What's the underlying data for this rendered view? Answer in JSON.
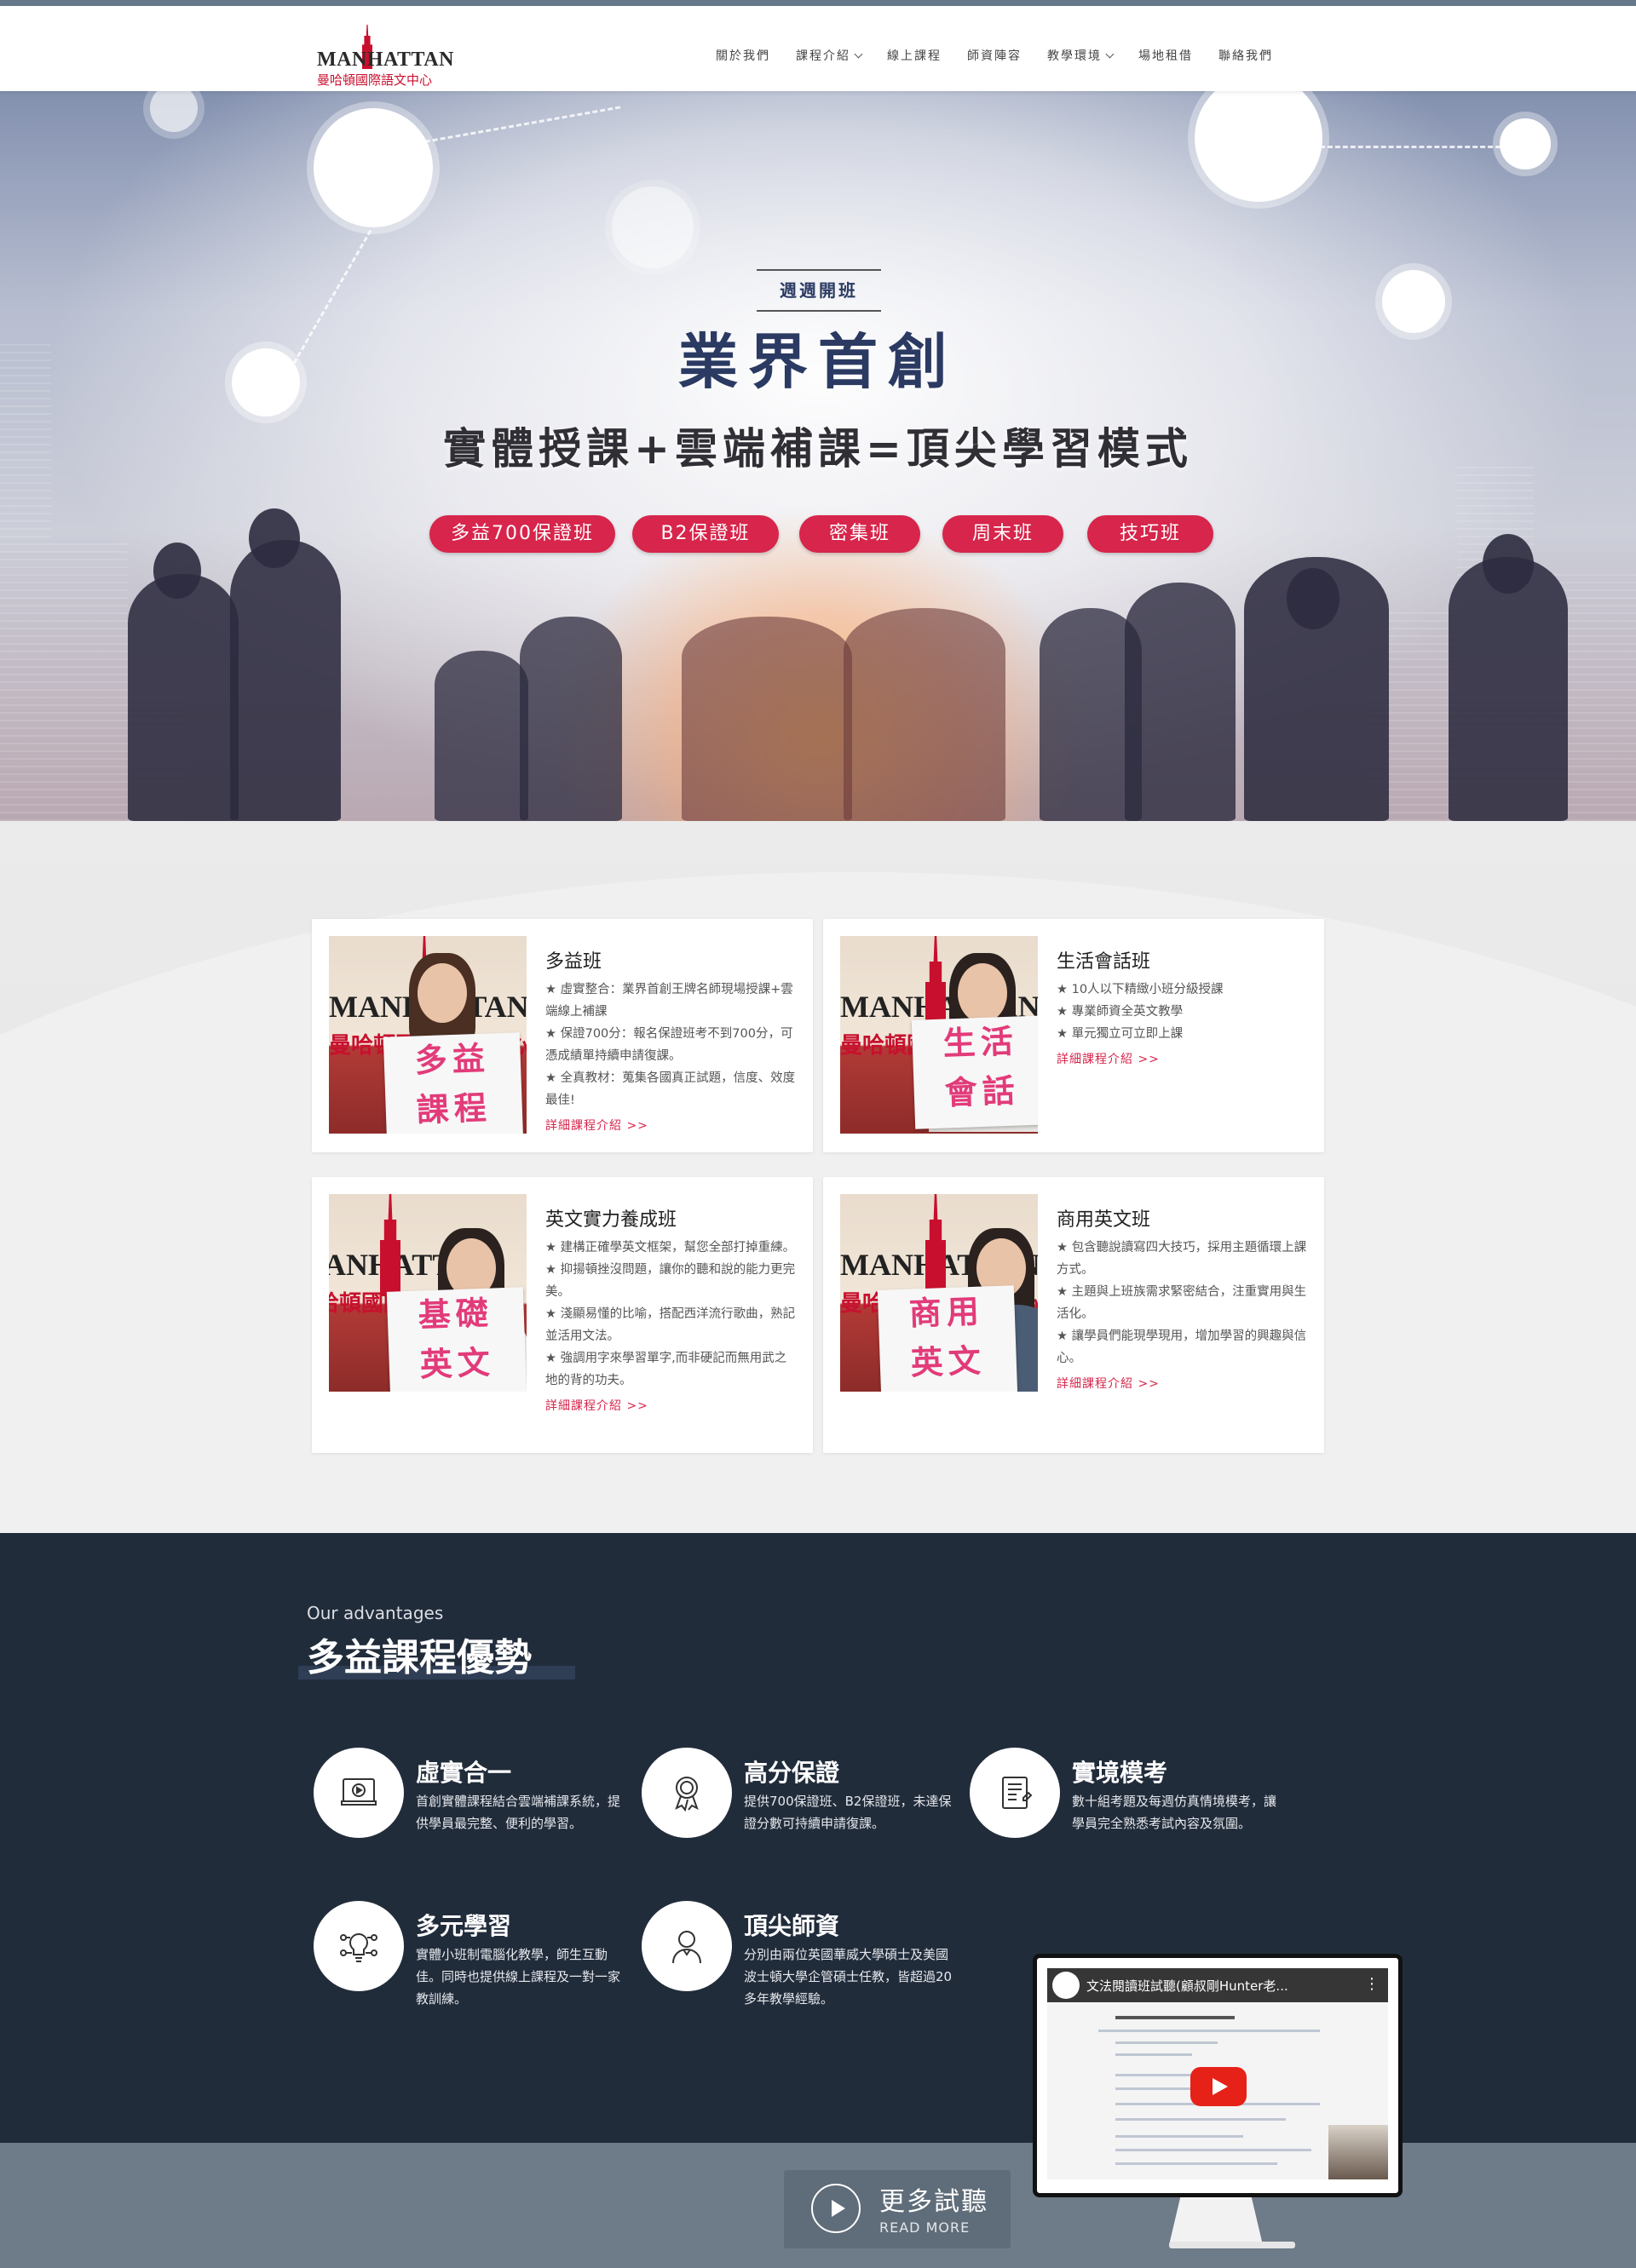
{
  "header": {
    "logo_word": "MANHATTAN",
    "logo_sub": "曼哈頓國際語文中心",
    "nav": [
      {
        "label": "關於我們",
        "has_dropdown": false
      },
      {
        "label": "課程介紹",
        "has_dropdown": true
      },
      {
        "label": "線上課程",
        "has_dropdown": false
      },
      {
        "label": "師資陣容",
        "has_dropdown": false
      },
      {
        "label": "教學環境",
        "has_dropdown": true
      },
      {
        "label": "場地租借",
        "has_dropdown": false
      },
      {
        "label": "聯絡我們",
        "has_dropdown": false
      }
    ]
  },
  "hero": {
    "badge": "週週開班",
    "title": "業界首創",
    "subtitle": "實體授課+雲端補課=頂尖學習模式",
    "pills": [
      "多益700保證班",
      "B2保證班",
      "密集班",
      "周末班",
      "技巧班"
    ]
  },
  "courses": [
    {
      "title": "多益班",
      "sign": [
        "多益",
        "課程"
      ],
      "lines": [
        "★ 虛實整合：業界首創王牌名師現場授課+雲端線上補課",
        "★ 保證700分：報名保證班考不到700分，可憑成績單持續申請復課。",
        "★ 全真教材：蒐集各國真正試題，信度、效度最佳!"
      ],
      "link": "詳細課程介紹 >>"
    },
    {
      "title": "生活會話班",
      "sign": [
        "生活",
        "會話"
      ],
      "lines": [
        "★ 10人以下精緻小班分級授課",
        "★ 專業師資全英文教學",
        "★ 單元獨立可立即上課"
      ],
      "link": "詳細課程介紹 >>"
    },
    {
      "title": "英文實力養成班",
      "sign": [
        "基礎",
        "英文"
      ],
      "lines": [
        "★ 建構正確學英文框架，幫您全部打掉重練。",
        "★ 抑揚頓挫沒問題，讓你的聽和說的能力更完美。",
        "★ 淺顯易懂的比喻，搭配西洋流行歌曲，熟記並活用文法。",
        "★ 強調用字來學習單字,而非硬記而無用武之地的背的功夫。"
      ],
      "link": "詳細課程介紹 >>"
    },
    {
      "title": "商用英文班",
      "sign": [
        "商用",
        "英文"
      ],
      "lines": [
        "★ 包含聽說讀寫四大技巧，採用主題循環上課方式。",
        "★ 主題與上班族需求緊密結合，注重實用與生活化。",
        "★ 讓學員們能現學現用，增加學習的興趣與信心。"
      ],
      "link": "詳細課程介紹 >>"
    }
  ],
  "advantages": {
    "eyebrow": "Our advantages",
    "title": "多益課程優勢",
    "items": [
      {
        "icon": "video-book-icon",
        "name": "虛實合一",
        "desc": "首創實體課程結合雲端補課系統，提供學員最完整、便利的學習。"
      },
      {
        "icon": "award-ribbon-icon",
        "name": "高分保證",
        "desc": "提供700保證班、B2保證班，未達保證分數可持續申請復課。"
      },
      {
        "icon": "exam-paper-icon",
        "name": "實境模考",
        "desc": "數十組考題及每週仿真情境模考，讓學員完全熟悉考試內容及氛圍。"
      },
      {
        "icon": "lightbulb-network-icon",
        "name": "多元學習",
        "desc": "實體小班制電腦化教學，師生互動佳。同時也提供線上課程及一對一家教訓練。"
      },
      {
        "icon": "teacher-person-icon",
        "name": "頂尖師資",
        "desc": "分別由兩位英國華威大學碩士及美國波士頓大學企管碩士任教，皆超過20多年教學經驗。"
      }
    ]
  },
  "video": {
    "title": "文法閱讀班試聽(顧叔剛Hunter老..."
  },
  "more_button": {
    "label": "更多試聽",
    "sub_label": "READ MORE"
  },
  "colors": {
    "brand_red": "#d7254b",
    "navy": "#212c3b",
    "hero_text": "#2b3a62"
  }
}
